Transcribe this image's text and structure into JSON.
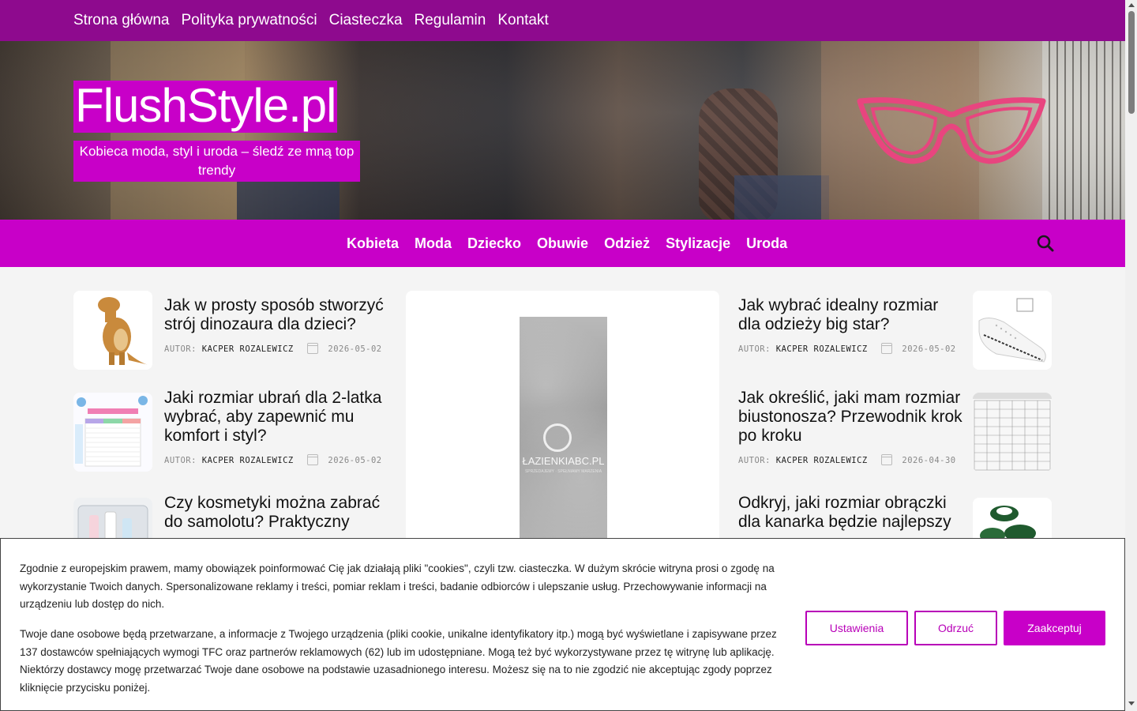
{
  "top_nav": {
    "items": [
      "Strona główna",
      "Polityka prywatności",
      "Ciasteczka",
      "Regulamin",
      "Kontakt"
    ]
  },
  "header": {
    "title": "FlushStyle.pl",
    "tagline": "Kobieca moda, styl i uroda – śledź ze mną top trendy"
  },
  "main_nav": {
    "items": [
      "Kobieta",
      "Moda",
      "Dziecko",
      "Obuwie",
      "Odzież",
      "Stylizacje",
      "Uroda"
    ],
    "search_icon": "search-icon"
  },
  "posts_left": [
    {
      "title": "Jak w prosty sposób stworzyć strój dinozaura dla dzieci?",
      "author_label": "AUTOR:",
      "author": "KACPER ROZALEWICZ",
      "date": "2026-05-02",
      "thumb": "dinosaur-costume-image"
    },
    {
      "title": "Jaki rozmiar ubrań dla 2-latka wybrać, aby zapewnić mu komfort i styl?",
      "author_label": "AUTOR:",
      "author": "KACPER ROZALEWICZ",
      "date": "2026-05-02",
      "thumb": "size-chart-image"
    },
    {
      "title": "Czy kosmetyki można zabrać do samolotu? Praktyczny",
      "thumb": "cosmetics-bag-image"
    }
  ],
  "posts_right": [
    {
      "title": "Jak wybrać idealny rozmiar dla odzieży big star?",
      "author_label": "AUTOR:",
      "author": "KACPER ROZALEWICZ",
      "date": "2026-05-02",
      "thumb": "white-sneaker-image"
    },
    {
      "title": "Jak określić, jaki mam rozmiar biustonosza? Przewodnik krok po kroku",
      "author_label": "AUTOR:",
      "author": "KACPER ROZALEWICZ",
      "date": "2026-04-30",
      "thumb": "bra-size-table-image"
    },
    {
      "title": "Odkryj, jaki rozmiar obrączki dla kanarka będzie najlepszy",
      "thumb": "bird-rings-image"
    }
  ],
  "center_ad": {
    "logo_text": "ŁAZIENKIABC.PL",
    "logo_sub": "SPRZEDAJEMY · SPEŁNIAMY MARZENIA"
  },
  "cookie_banner": {
    "paragraph1": "Zgodnie z europejskim prawem, mamy obowiązek poinformować Cię jak działają pliki \"cookies\", czyli tzw. ciasteczka. W dużym skrócie witryna prosi o zgodę na wykorzystanie Twoich danych. Spersonalizowane reklamy i treści, pomiar reklam i treści, badanie odbiorców i ulepszanie usług. Przechowywanie informacji na urządzeniu lub dostęp do nich.",
    "paragraph2": "Twoje dane osobowe będą przetwarzane, a informacje z Twojego urządzenia (pliki cookie, unikalne identyfikatory itp.) mogą być wyświetlane i zapisywane przez 137 dostawców spełniających wymogi TFC oraz partnerów reklamowych (62) lub im udostępniane. Mogą też być wykorzystywane przez tę witrynę lub aplikację. Niektórzy dostawcy mogę przetwarzać Twoje dane osobowe na podstawie uzasadnionego interesu. Możesz się na to nie zgodzić nie akceptując zgody poprzez kliknięcie przycisku poniżej.",
    "buttons": {
      "settings": "Ustawienia",
      "reject": "Odrzuć",
      "accept": "Zaakceptuj"
    }
  },
  "colors": {
    "top_bar": "#8e0a8e",
    "brand": "#c800c8",
    "glasses": "#e8457f"
  }
}
